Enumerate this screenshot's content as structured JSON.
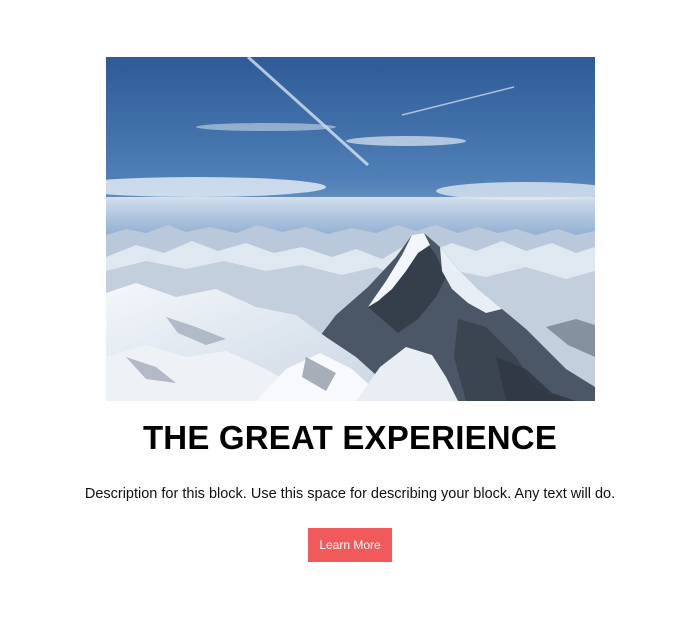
{
  "hero": {
    "image_subject": "snowy-mountain-range-under-blue-sky"
  },
  "block": {
    "title": "THE GREAT EXPERIENCE",
    "description": "Description for this block. Use this space for describing your block. Any text will do.",
    "button_label": "Learn More"
  },
  "colors": {
    "button_background": "#f05a5a",
    "button_text": "#ffffff",
    "page_background": "#ffffff",
    "sky_top": "#2f5f9c",
    "sky_bottom": "#c6d8ea"
  }
}
